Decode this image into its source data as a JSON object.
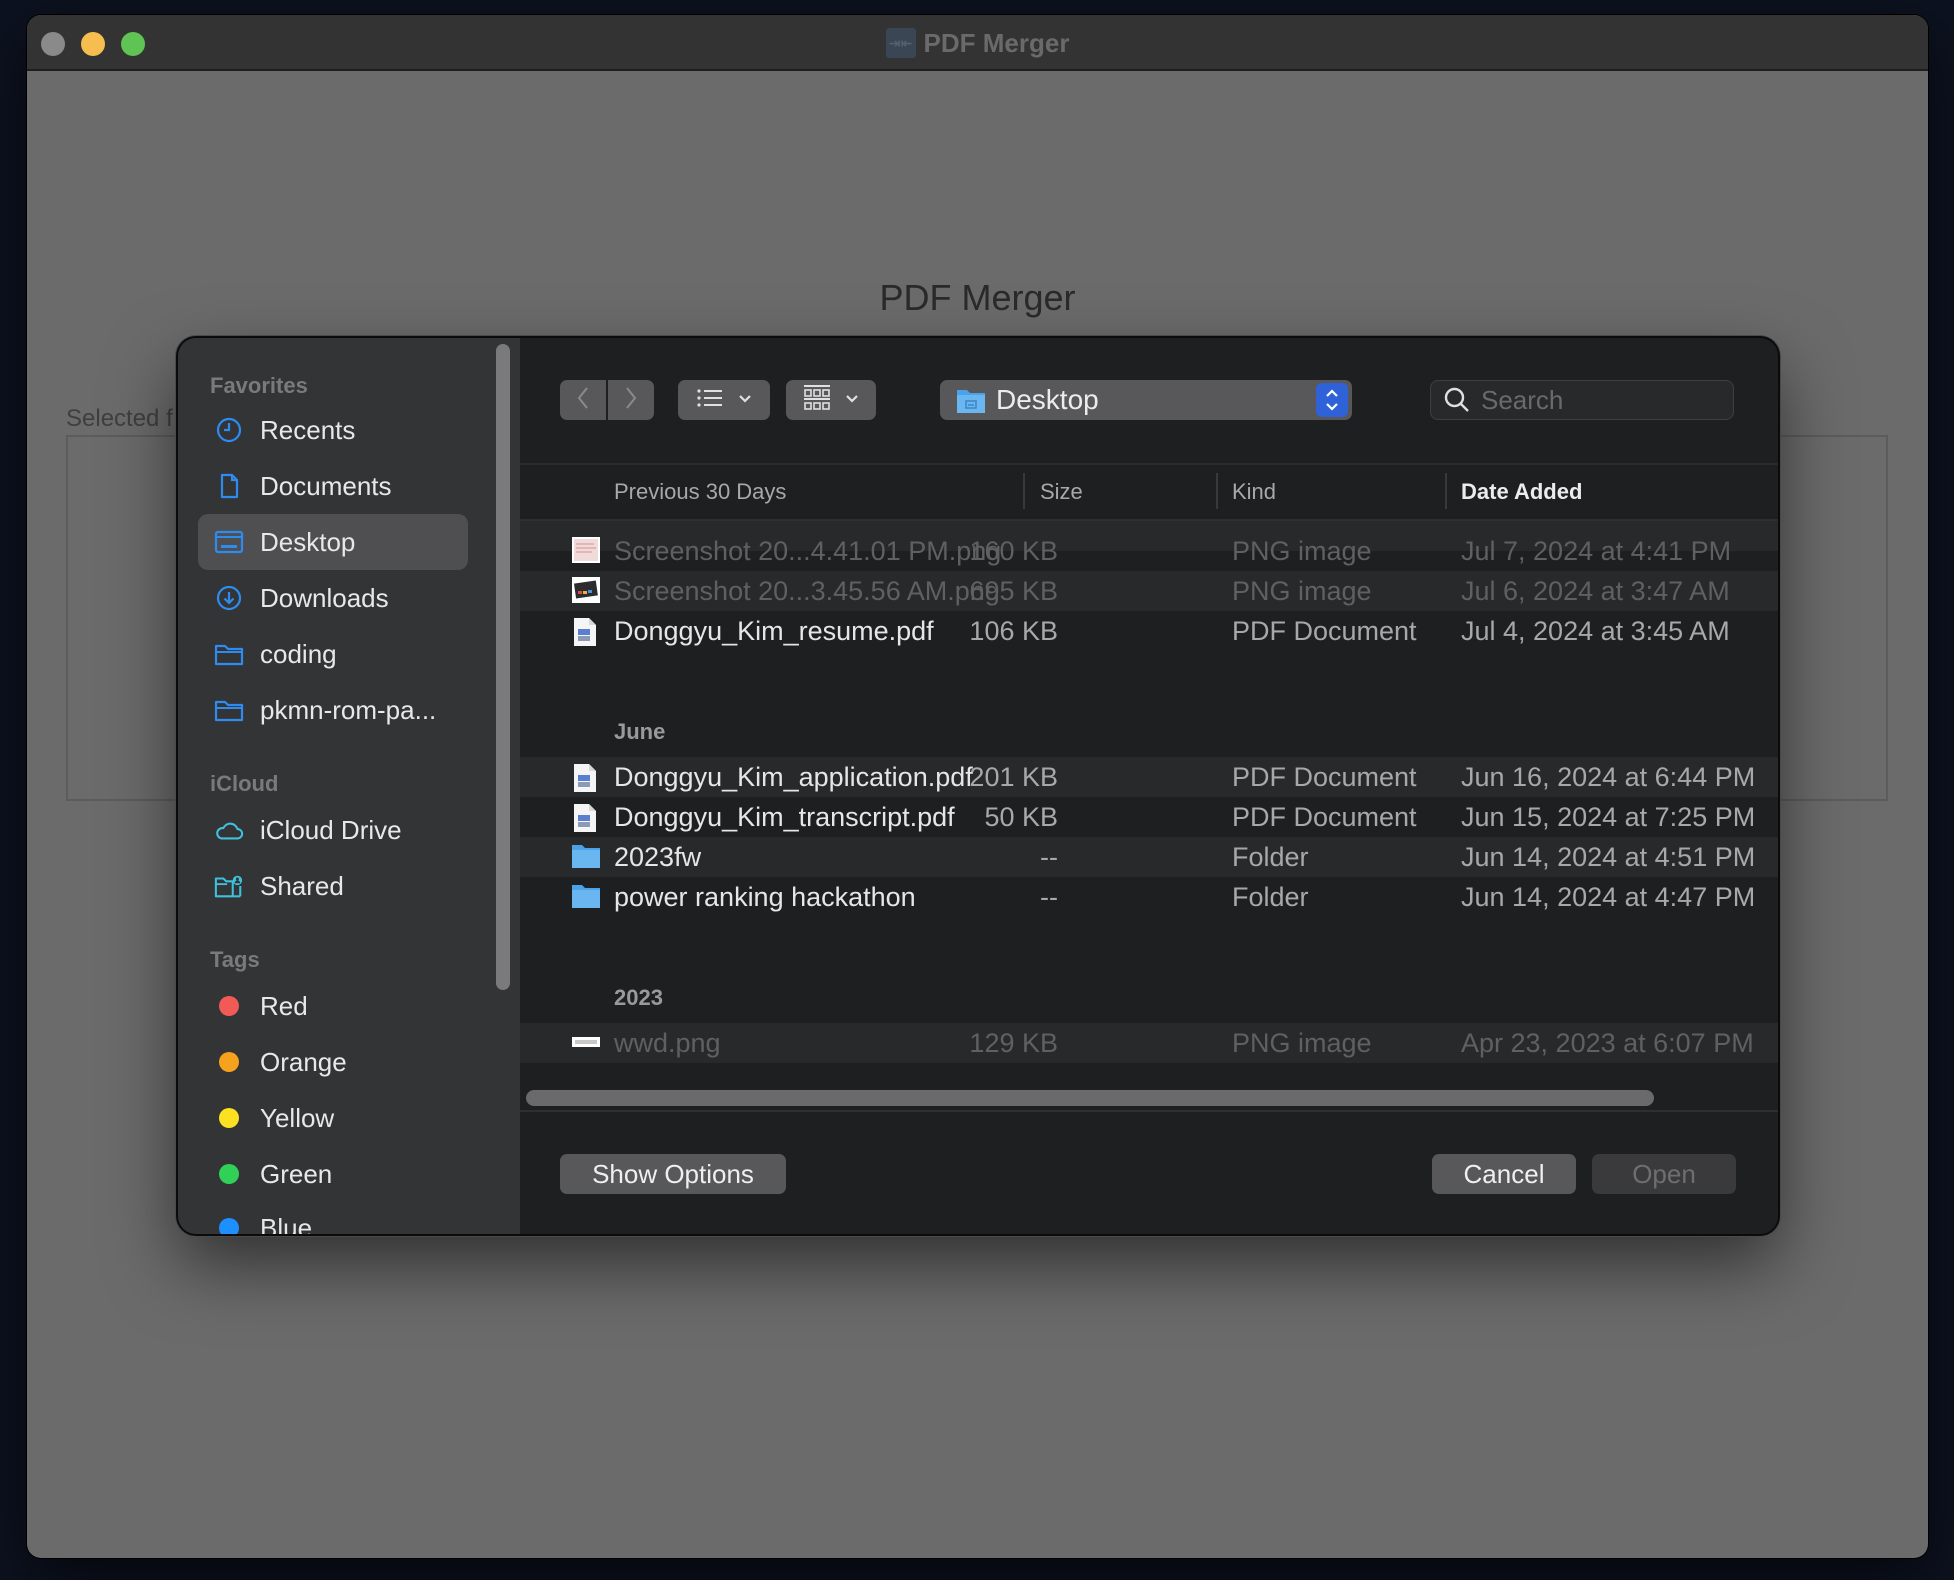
{
  "window": {
    "title": "PDF Merger",
    "app_icon_glyph": "⇥⇤"
  },
  "app": {
    "heading": "PDF Merger",
    "selected_files_label": "Selected f"
  },
  "dialog": {
    "sidebar": {
      "sections": [
        {
          "title": "Favorites",
          "items": [
            {
              "label": "Recents",
              "icon": "clock-icon"
            },
            {
              "label": "Documents",
              "icon": "document-icon"
            },
            {
              "label": "Desktop",
              "icon": "desktop-icon",
              "selected": true
            },
            {
              "label": "Downloads",
              "icon": "download-icon"
            },
            {
              "label": "coding",
              "icon": "folder-icon"
            },
            {
              "label": "pkmn-rom-pa...",
              "icon": "folder-icon"
            }
          ]
        },
        {
          "title": "iCloud",
          "items": [
            {
              "label": "iCloud Drive",
              "icon": "cloud-icon"
            },
            {
              "label": "Shared",
              "icon": "shared-folder-icon"
            }
          ]
        },
        {
          "title": "Tags",
          "items": [
            {
              "label": "Red",
              "color": "#f25a55"
            },
            {
              "label": "Orange",
              "color": "#f6a21d"
            },
            {
              "label": "Yellow",
              "color": "#fbe122"
            },
            {
              "label": "Green",
              "color": "#31d158"
            },
            {
              "label": "Blue",
              "color": "#1e8fff"
            }
          ]
        }
      ]
    },
    "toolbar": {
      "back_icon": "chevron-left-icon",
      "forward_icon": "chevron-right-icon",
      "list_view_icon": "list-view-icon",
      "icon_view_icon": "grid-view-icon",
      "location": "Desktop",
      "search_placeholder": "Search",
      "search_value": ""
    },
    "columns": {
      "name": "Previous 30 Days",
      "size": "Size",
      "kind": "Kind",
      "date": "Date Added"
    },
    "groups": [
      {
        "label": "",
        "files": [
          {
            "name": "Screenshot 20...4.41.01 PM.png",
            "size": "160 KB",
            "kind": "PNG image",
            "date": "Jul 7, 2024 at 4:41 PM",
            "type": "png-light",
            "enabled": false
          },
          {
            "name": "Screenshot 20...3.45.56 AM.png",
            "size": "695 KB",
            "kind": "PNG image",
            "date": "Jul 6, 2024 at 3:47 AM",
            "type": "png-dark",
            "enabled": false
          },
          {
            "name": "Donggyu_Kim_resume.pdf",
            "size": "106 KB",
            "kind": "PDF Document",
            "date": "Jul 4, 2024 at 3:45 AM",
            "type": "pdf",
            "enabled": true
          }
        ]
      },
      {
        "label": "June",
        "files": [
          {
            "name": "Donggyu_Kim_application.pdf",
            "size": "201 KB",
            "kind": "PDF Document",
            "date": "Jun 16, 2024 at 6:44 PM",
            "type": "pdf",
            "enabled": true
          },
          {
            "name": "Donggyu_Kim_transcript.pdf",
            "size": "50 KB",
            "kind": "PDF Document",
            "date": "Jun 15, 2024 at 7:25 PM",
            "type": "pdf",
            "enabled": true
          },
          {
            "name": "2023fw",
            "size": "--",
            "kind": "Folder",
            "date": "Jun 14, 2024 at 4:51 PM",
            "type": "folder",
            "enabled": true
          },
          {
            "name": "power ranking hackathon",
            "size": "--",
            "kind": "Folder",
            "date": "Jun 14, 2024 at 4:47 PM",
            "type": "folder",
            "enabled": true
          }
        ]
      },
      {
        "label": "2023",
        "files": [
          {
            "name": "wwd.png",
            "size": "129 KB",
            "kind": "PNG image",
            "date": "Apr 23, 2023 at 6:07 PM",
            "type": "png-strip",
            "enabled": false
          }
        ]
      }
    ],
    "buttons": {
      "show_options": "Show Options",
      "cancel": "Cancel",
      "open": "Open"
    }
  }
}
